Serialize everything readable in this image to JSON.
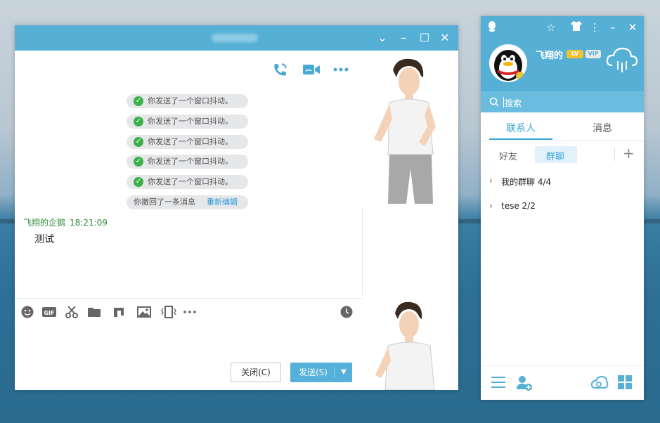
{
  "chat_window": {
    "tools": {
      "voice_call": "phone-icon",
      "video_call": "video-icon",
      "more": "more-icon"
    },
    "system_messages": [
      "你发送了一个窗口抖动。",
      "你发送了一个窗口抖动。",
      "你发送了一个窗口抖动。",
      "你发送了一个窗口抖动。",
      "你发送了一个窗口抖动。"
    ],
    "recall": {
      "text": "你撤回了一条消息",
      "link": "重新编辑"
    },
    "message": {
      "sender": "飞翔的企鹅",
      "time": "18:21:09",
      "text": "测试"
    },
    "buttons": {
      "close": "关闭(C)",
      "send": "发送(S)"
    }
  },
  "main_panel": {
    "user": {
      "nickname": "飞翔的",
      "level_badge": "LV",
      "vip_badge": "VIP"
    },
    "search": {
      "placeholder": "搜索"
    },
    "tabs": [
      "联系人",
      "消息"
    ],
    "sub_tabs": [
      "好友",
      "群聊"
    ],
    "groups": [
      {
        "name": "我的群聊 4/4"
      },
      {
        "name": "tese 2/2"
      }
    ]
  },
  "colors": {
    "accent": "#56b0d6",
    "link": "#2d9cdb",
    "sender": "#2f8a3c"
  }
}
